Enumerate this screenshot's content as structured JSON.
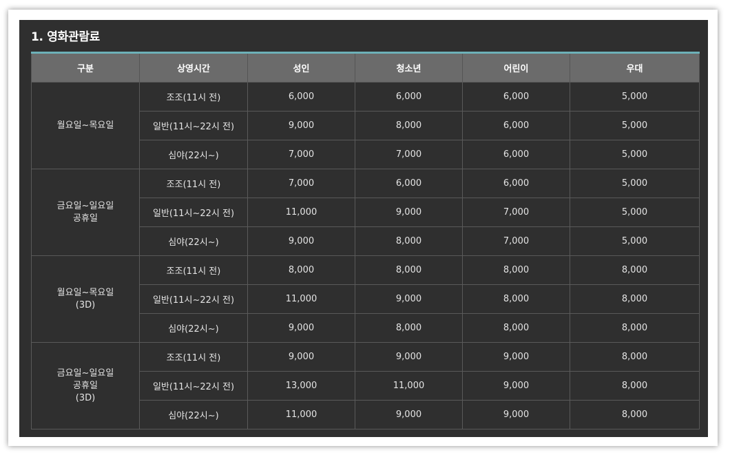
{
  "title": "1. 영화관람료",
  "table": {
    "headers": [
      "구분",
      "상영시간",
      "성인",
      "청소년",
      "어린이",
      "우대"
    ],
    "groups": [
      {
        "label_lines": [
          "월요일~목요일"
        ],
        "rows": [
          {
            "time": "조조(11시 전)",
            "adult": "6,000",
            "teen": "6,000",
            "child": "6,000",
            "discount": "5,000"
          },
          {
            "time": "일반(11시~22시 전)",
            "adult": "9,000",
            "teen": "8,000",
            "child": "6,000",
            "discount": "5,000"
          },
          {
            "time": "심야(22시~)",
            "adult": "7,000",
            "teen": "7,000",
            "child": "6,000",
            "discount": "5,000"
          }
        ]
      },
      {
        "label_lines": [
          "금요일~일요일",
          "공휴일"
        ],
        "rows": [
          {
            "time": "조조(11시 전)",
            "adult": "7,000",
            "teen": "6,000",
            "child": "6,000",
            "discount": "5,000"
          },
          {
            "time": "일반(11시~22시 전)",
            "adult": "11,000",
            "teen": "9,000",
            "child": "7,000",
            "discount": "5,000"
          },
          {
            "time": "심야(22시~)",
            "adult": "9,000",
            "teen": "8,000",
            "child": "7,000",
            "discount": "5,000"
          }
        ]
      },
      {
        "label_lines": [
          "월요일~목요일",
          "(3D)"
        ],
        "rows": [
          {
            "time": "조조(11시 전)",
            "adult": "8,000",
            "teen": "8,000",
            "child": "8,000",
            "discount": "8,000"
          },
          {
            "time": "일반(11시~22시 전)",
            "adult": "11,000",
            "teen": "9,000",
            "child": "8,000",
            "discount": "8,000"
          },
          {
            "time": "심야(22시~)",
            "adult": "9,000",
            "teen": "8,000",
            "child": "8,000",
            "discount": "8,000"
          }
        ]
      },
      {
        "label_lines": [
          "금요일~일요일",
          "공휴일",
          "(3D)"
        ],
        "rows": [
          {
            "time": "조조(11시 전)",
            "adult": "9,000",
            "teen": "9,000",
            "child": "9,000",
            "discount": "8,000"
          },
          {
            "time": "일반(11시~22시 전)",
            "adult": "13,000",
            "teen": "11,000",
            "child": "9,000",
            "discount": "8,000"
          },
          {
            "time": "심야(22시~)",
            "adult": "11,000",
            "teen": "9,000",
            "child": "9,000",
            "discount": "8,000"
          }
        ]
      }
    ]
  },
  "colors": {
    "panel_background": "#2f2f2f",
    "header_background": "#6b6b6b",
    "accent_line": "#6db1b8",
    "text": "#e4e4e4"
  }
}
